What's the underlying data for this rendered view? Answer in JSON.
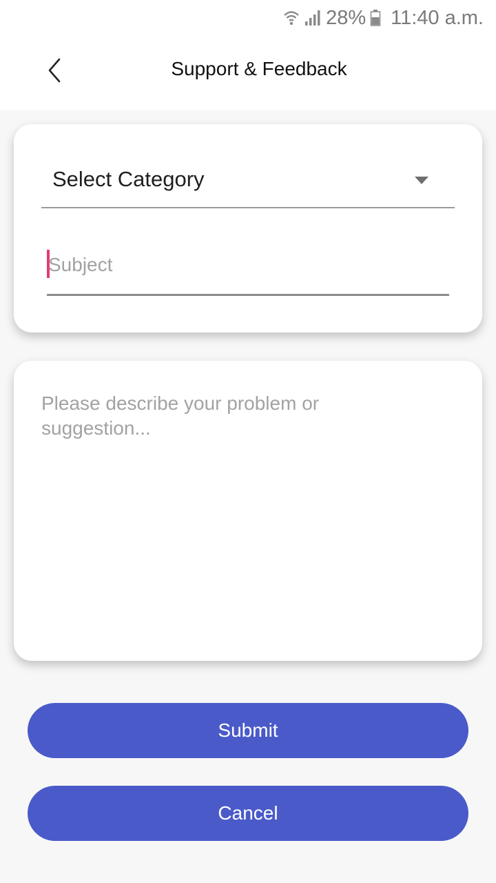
{
  "status_bar": {
    "battery_percent": "28%",
    "time": "11:40 a.m.",
    "icons": [
      "wifi-icon",
      "signal-icon",
      "battery-icon"
    ]
  },
  "header": {
    "back_icon": "chevron-left-icon",
    "title": "Support & Feedback"
  },
  "form": {
    "category": {
      "selected_label": "Select Category",
      "icon": "dropdown-arrow-icon"
    },
    "subject": {
      "placeholder": "Subject",
      "value": ""
    },
    "description": {
      "placeholder": "Please describe your problem or suggestion...",
      "value": ""
    }
  },
  "actions": {
    "submit_label": "Submit",
    "cancel_label": "Cancel"
  },
  "colors": {
    "accent": "#4a5ac9",
    "cursor": "#e23a7a",
    "background": "#f7f7f7",
    "card": "#ffffff"
  }
}
